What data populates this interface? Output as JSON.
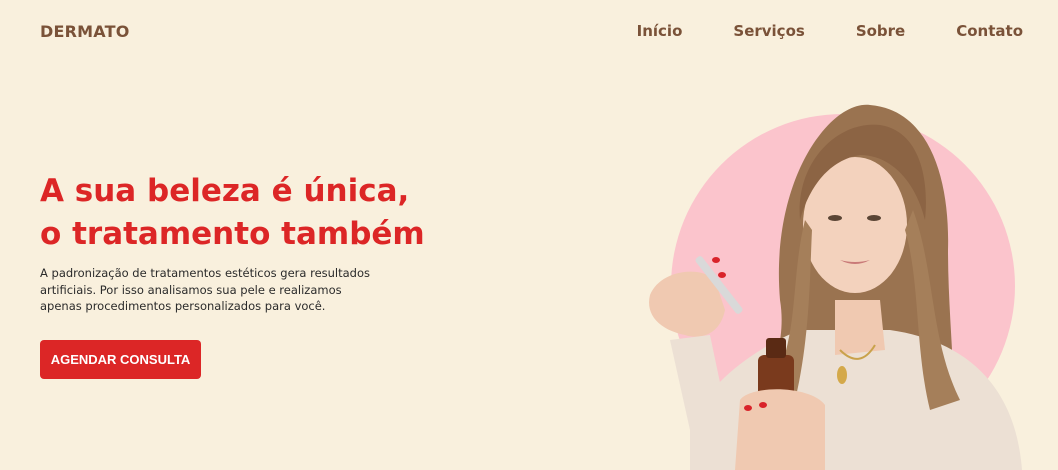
{
  "header": {
    "logo": "DERMATO",
    "nav": [
      "Início",
      "Serviços",
      "Sobre",
      "Contato"
    ]
  },
  "hero": {
    "title_line1": "A sua beleza é única,",
    "title_line2": "o tratamento também",
    "description": "A padronização de tratamentos estéticos gera resultados artificiais. Por isso analisamos sua pele e realizamos apenas procedimentos personalizados para você.",
    "cta_label": "AGENDAR CONSULTA"
  },
  "colors": {
    "background": "#f9f0dd",
    "brand_brown": "#7a5238",
    "accent_red": "#dc2626",
    "circle_pink": "#fbc4cc"
  }
}
